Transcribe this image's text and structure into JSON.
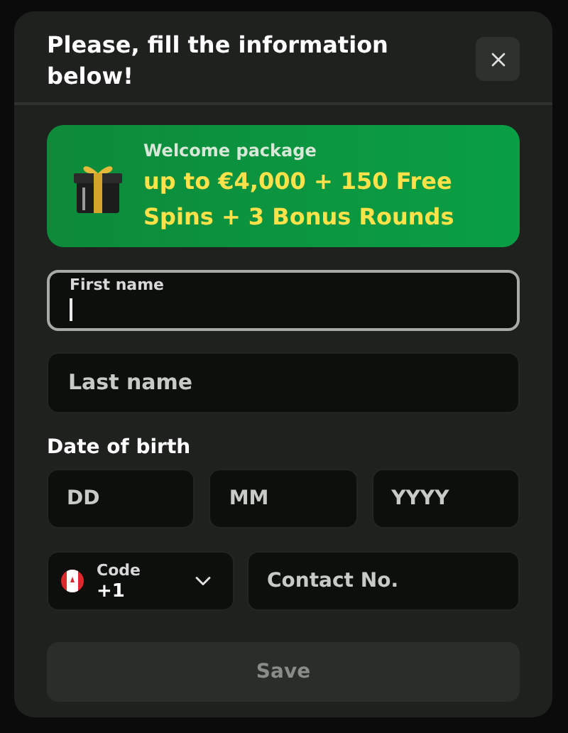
{
  "dialog": {
    "title": "Please, fill the information below!"
  },
  "banner": {
    "caption": "Welcome package",
    "offer": "up to €4,000 + 150 Free Spins + 3 Bonus Rounds"
  },
  "fields": [
    {
      "placeholder": "First name",
      "focused": true
    },
    {
      "placeholder": "Last name",
      "focused": false
    }
  ],
  "date_of_birth": {
    "label": "Date of birth",
    "fields": [
      {
        "placeholder": "DD"
      },
      {
        "placeholder": "MM"
      },
      {
        "placeholder": "YYYY"
      }
    ]
  },
  "phone": {
    "code_label": "Code",
    "code_value": "+1",
    "placeholder": "Contact No."
  },
  "save_button": {
    "label": "Save",
    "disabled": true
  }
}
